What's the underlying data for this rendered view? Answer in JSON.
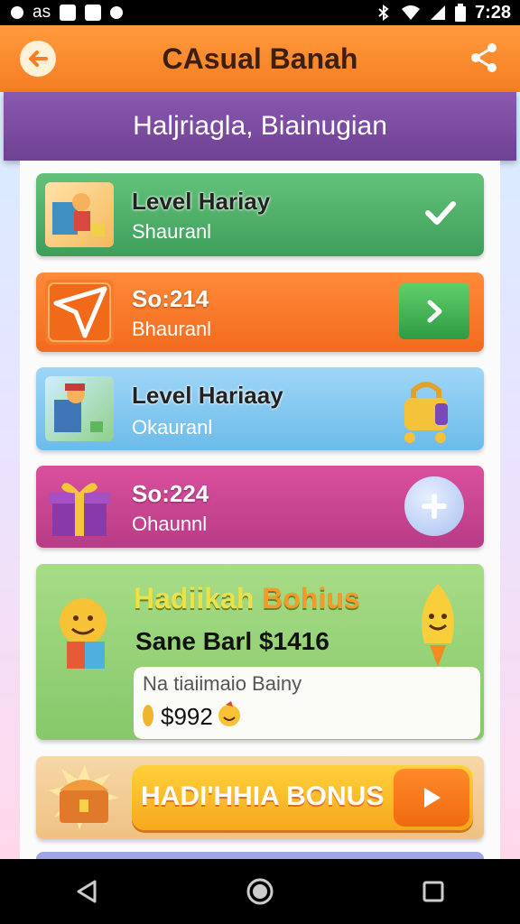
{
  "status_bar": {
    "left_text": "as",
    "time": "7:28",
    "icons": [
      "notification-icon",
      "image-icon",
      "app-icon",
      "record-icon",
      "bluetooth-icon",
      "wifi-icon",
      "signal-icon",
      "battery-icon"
    ]
  },
  "app_bar": {
    "title": "CAsual Banah",
    "back_icon": "back-arrow-icon",
    "share_icon": "share-icon",
    "color": "#f57d22"
  },
  "subheader": {
    "title": "Haljriagla, Biainugian",
    "color": "#7a4aa0"
  },
  "cards": [
    {
      "title": "Level Hariay",
      "subtitle": "Shauranl",
      "status": "completed",
      "action_icon": "checkmark-icon",
      "color": "#4fb16b"
    },
    {
      "title": "So:214",
      "subtitle": "Bhauranl",
      "action_icon": "chevron-right-icon",
      "color": "#f57a2a"
    },
    {
      "title": "Level Hariaay",
      "subtitle": "Okauranl",
      "action_icon": "lock-icon",
      "color": "#84c8f0"
    },
    {
      "title": "So:224",
      "subtitle": "Ohaunnl",
      "action_icon": "plus-icon",
      "color": "#c9458f"
    }
  ],
  "bonus_card": {
    "title_part1": "Hadiikah",
    "title_part2": "Bohius",
    "subtitle": "Sane Barl $1416",
    "inner_label": "Na tiaiimaio Bainy",
    "inner_amount": "$992",
    "color": "#94d075"
  },
  "cta": {
    "label": "HADI'HHIA BONUS",
    "icon": "treasure-chest-icon",
    "arrow_icon": "play-arrow-icon"
  },
  "nav_bar": {
    "buttons": [
      "back-triangle-icon",
      "home-circle-icon",
      "recents-square-icon"
    ]
  }
}
